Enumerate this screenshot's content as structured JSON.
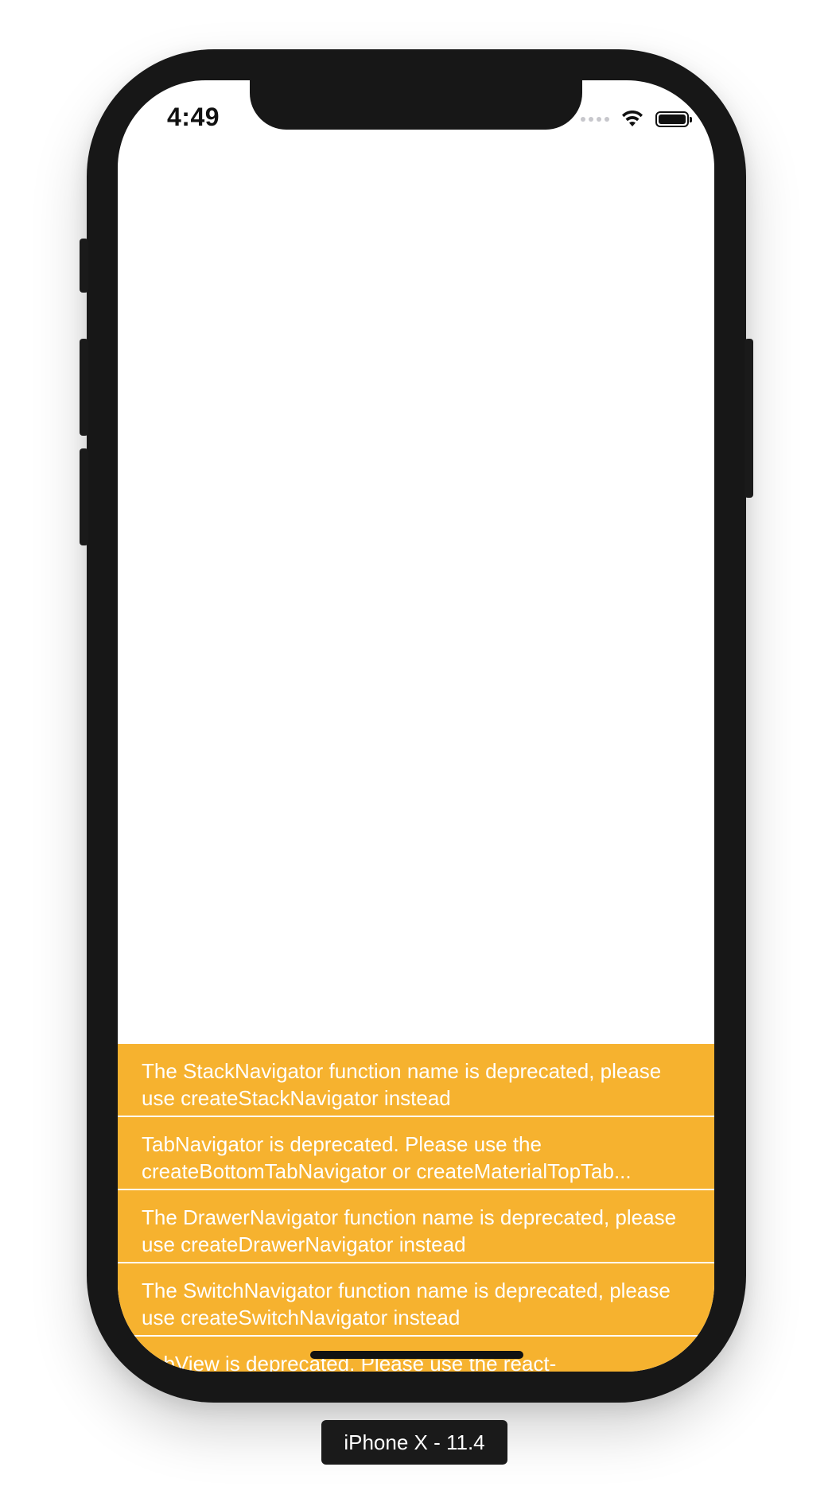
{
  "status_bar": {
    "time": "4:49",
    "icons": [
      "signal-dots-icon",
      "wifi-icon",
      "battery-icon"
    ]
  },
  "warnings": [
    "The StackNavigator function name is deprecated, please use createStackNavigator instead",
    "TabNavigator is deprecated. Please use the createBottomTabNavigator or createMaterialTopTab...",
    "The DrawerNavigator function name is deprecated, please use createDrawerNavigator instead",
    "The SwitchNavigator function name is deprecated, please use createSwitchNavigator instead",
    "TabView is deprecated. Please use the react-"
  ],
  "device_label": "iPhone X - 11.4",
  "colors": {
    "warning_background": "#f6b22f",
    "device_frame": "#171717"
  }
}
